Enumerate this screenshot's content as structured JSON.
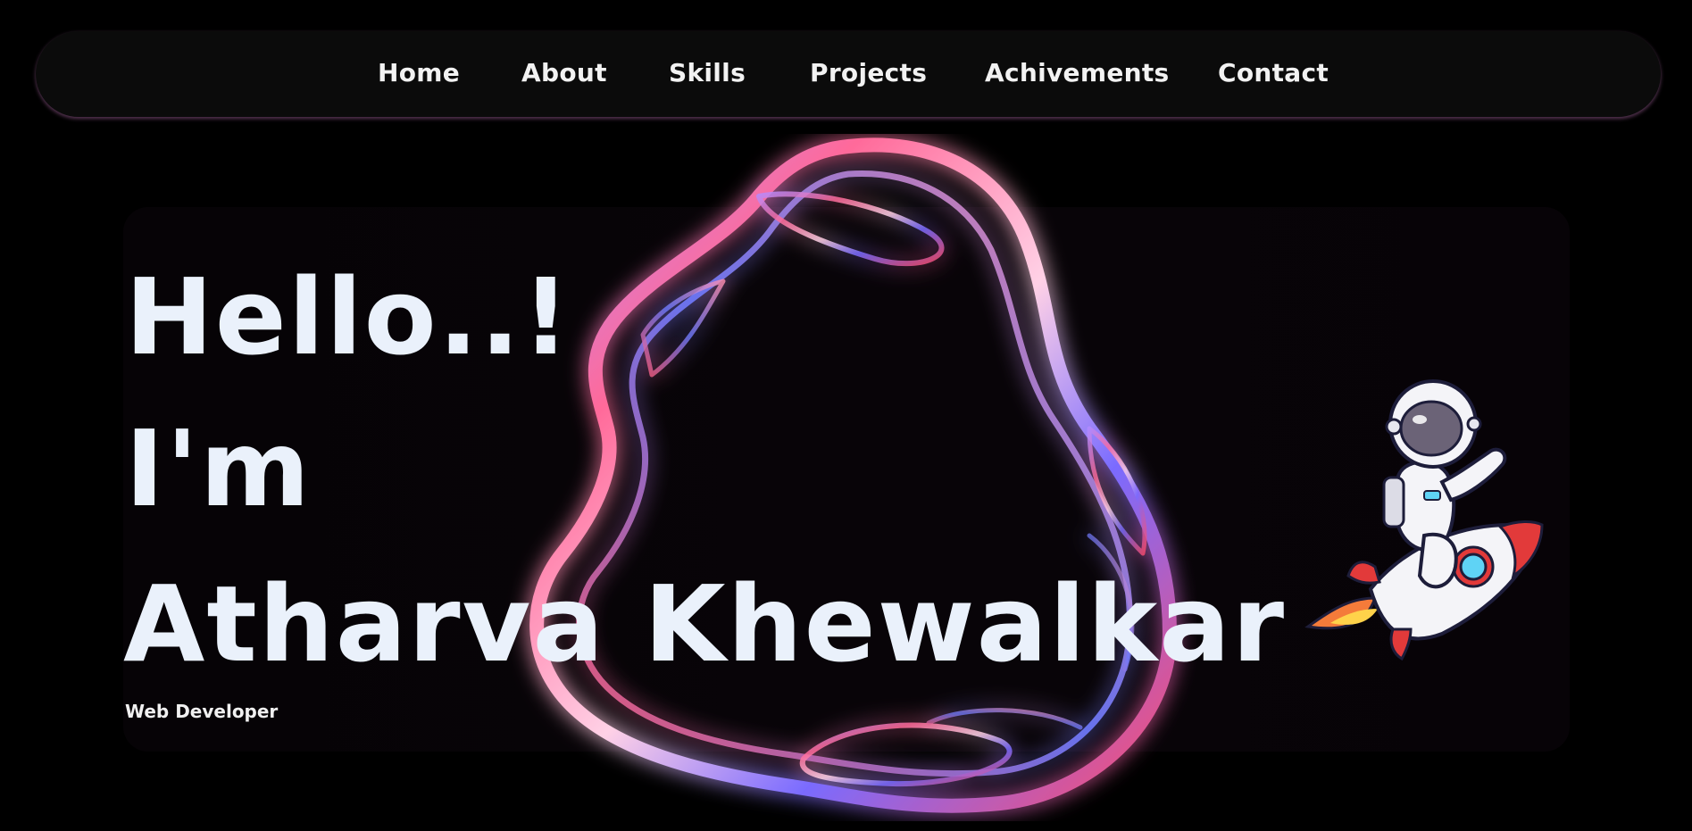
{
  "nav": {
    "items": [
      {
        "label": "Home"
      },
      {
        "label": "About"
      },
      {
        "label": "Skills"
      },
      {
        "label": "Projects"
      },
      {
        "label": "Achivements"
      },
      {
        "label": "Contact"
      }
    ]
  },
  "hero": {
    "greeting": "Hello..!",
    "intro": "I'm",
    "name": "Atharva Khewalkar",
    "role": "Web Developer"
  },
  "colors": {
    "background": "#000000",
    "navbar": "#0b0b0b",
    "text": "#eaf1fb",
    "blob_pink": "#ff5a8a",
    "blob_purple": "#8a6bff"
  },
  "icons": {
    "blob": "chrome-blob-ring",
    "mascot": "astronaut-on-rocket"
  }
}
